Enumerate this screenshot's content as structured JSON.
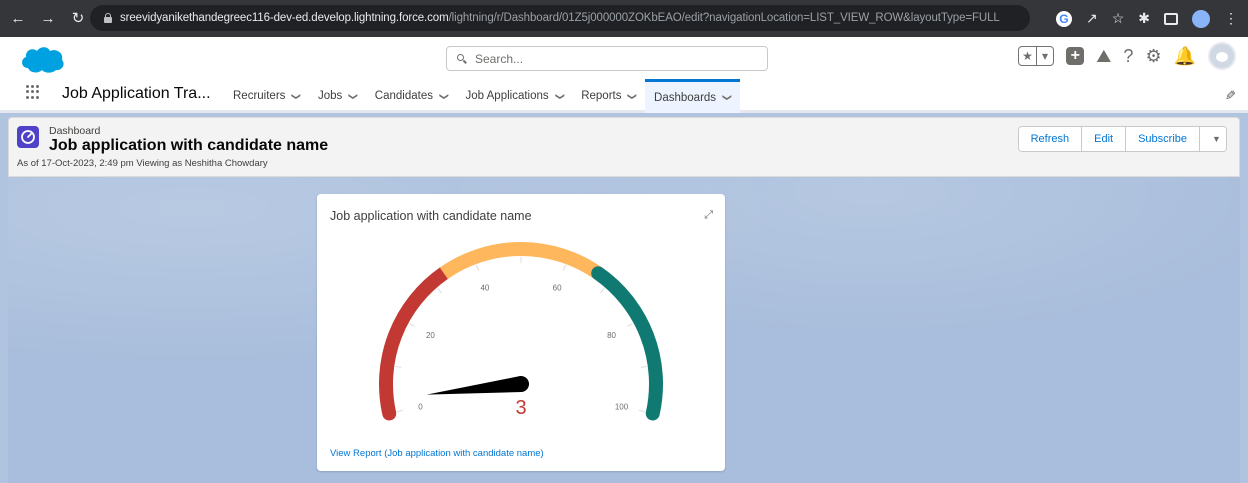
{
  "browser": {
    "url_domain": "sreevidyanikethandegreec116-dev-ed.develop.lightning.force.com",
    "url_path": "/lightning/r/Dashboard/01Z5j000000ZOKbEAO/edit?navigationLocation=LIST_VIEW_ROW&layoutType=FULL"
  },
  "header": {
    "search_placeholder": "Search..."
  },
  "nav": {
    "app_name": "Job Application Tra...",
    "items": [
      {
        "label": "Recruiters"
      },
      {
        "label": "Jobs"
      },
      {
        "label": "Candidates"
      },
      {
        "label": "Job Applications"
      },
      {
        "label": "Reports"
      },
      {
        "label": "Dashboards"
      }
    ],
    "active_index": 5
  },
  "page": {
    "breadcrumb": "Dashboard",
    "title": "Job application with candidate name",
    "as_of": "As of 17-Oct-2023, 2:49 pm Viewing as Neshitha Chowdary",
    "buttons": {
      "refresh": "Refresh",
      "edit": "Edit",
      "subscribe": "Subscribe"
    }
  },
  "widget": {
    "title": "Job application with candidate name",
    "view_report": "View Report (Job application with candidate name)"
  },
  "chart_data": {
    "type": "gauge",
    "min": 0,
    "max": 100,
    "value": 3,
    "value_label": "3",
    "tick_labels": [
      "0",
      "20",
      "40",
      "60",
      "80",
      "100"
    ],
    "ticks": [
      0,
      20,
      40,
      60,
      80,
      100
    ],
    "bands": [
      {
        "from": 0,
        "to": 33,
        "color": "#c23934"
      },
      {
        "from": 33,
        "to": 67,
        "color": "#ffb75d"
      },
      {
        "from": 67,
        "to": 100,
        "color": "#107a72"
      }
    ],
    "needle_color": "#000000",
    "value_color": "#c23934"
  },
  "colors": {
    "brand": "#00a1e0",
    "accent": "#0176d3",
    "dashboard_icon": "#4f41c8"
  }
}
